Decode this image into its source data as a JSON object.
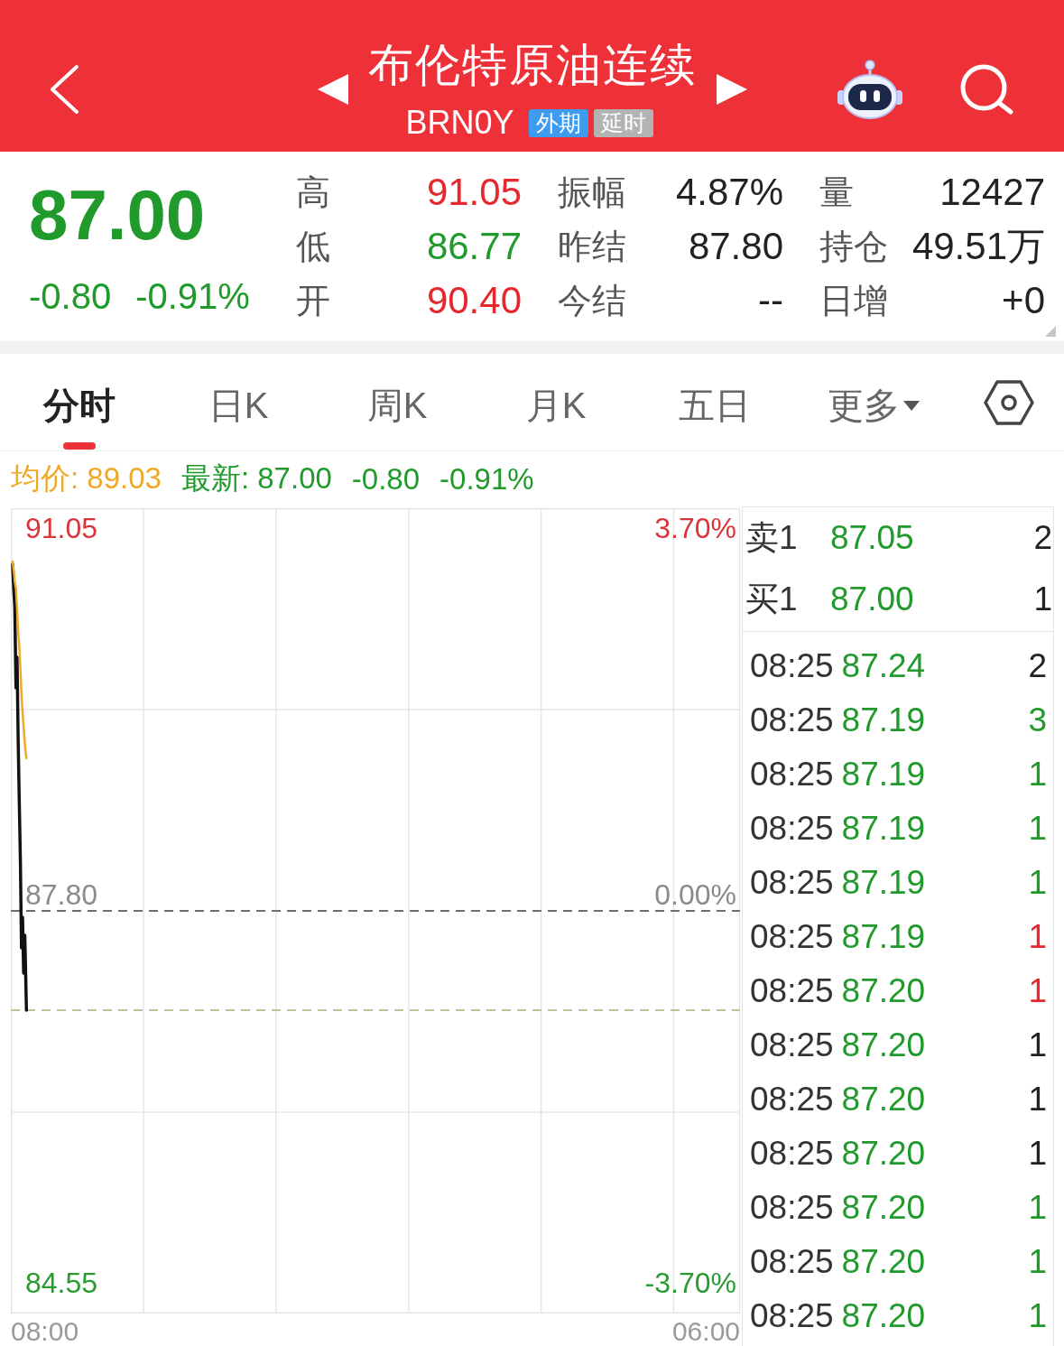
{
  "header": {
    "title": "布伦特原油连续",
    "code": "BRN0Y",
    "badges": [
      {
        "text": "外期",
        "color": "#3d9cf0"
      },
      {
        "text": "延时",
        "color": "#b3b3b3"
      }
    ]
  },
  "quote": {
    "price": "87.00",
    "change": "-0.80",
    "change_pct": "-0.91%",
    "color": "#1f9a2b",
    "stats": [
      {
        "label": "高",
        "value": "91.05",
        "color": "#e8262d"
      },
      {
        "label": "振幅",
        "value": "4.87%",
        "color": "#222222"
      },
      {
        "label": "量",
        "value": "12427",
        "color": "#222222"
      },
      {
        "label": "低",
        "value": "86.77",
        "color": "#1f9a2b"
      },
      {
        "label": "昨结",
        "value": "87.80",
        "color": "#222222"
      },
      {
        "label": "持仓",
        "value": "49.51万",
        "color": "#222222"
      },
      {
        "label": "开",
        "value": "90.40",
        "color": "#e8262d"
      },
      {
        "label": "今结",
        "value": "--",
        "color": "#222222"
      },
      {
        "label": "日增",
        "value": "+0",
        "color": "#222222"
      }
    ]
  },
  "tabs": [
    {
      "label": "分时",
      "selected": true,
      "kind": "plain"
    },
    {
      "label": "日K",
      "selected": false,
      "kind": "plain"
    },
    {
      "label": "周K",
      "selected": false,
      "kind": "plain"
    },
    {
      "label": "月K",
      "selected": false,
      "kind": "plain"
    },
    {
      "label": "五日",
      "selected": false,
      "kind": "plain"
    },
    {
      "label": "更多",
      "selected": false,
      "kind": "menu"
    }
  ],
  "indicators": [
    {
      "text": "均价: 89.03",
      "color": "#f0a829"
    },
    {
      "text": "最新: 87.00",
      "color": "#1f9a2b"
    },
    {
      "text": "-0.80",
      "color": "#1f9a2b"
    },
    {
      "text": "-0.91%",
      "color": "#1f9a2b"
    }
  ],
  "chart": {
    "left_labels": [
      {
        "text": "91.05",
        "color": "#d9343a"
      },
      {
        "text": "87.80",
        "color": "#8a8a8a"
      },
      {
        "text": "84.55",
        "color": "#2a9a32"
      }
    ],
    "right_labels": [
      {
        "text": "3.70%",
        "color": "#d9343a"
      },
      {
        "text": "0.00%",
        "color": "#8a8a8a"
      },
      {
        "text": "-3.70%",
        "color": "#2a9a32"
      }
    ],
    "time_labels": [
      "08:00",
      "06:00"
    ]
  },
  "order_book": [
    {
      "label": "卖1",
      "price": "87.05",
      "volume": "2"
    },
    {
      "label": "买1",
      "price": "87.00",
      "volume": "1"
    }
  ],
  "trades": [
    {
      "time": "08:25",
      "price": "87.24",
      "volume": "2",
      "color": "#222222"
    },
    {
      "time": "08:25",
      "price": "87.19",
      "volume": "3",
      "color": "#1f9a2b"
    },
    {
      "time": "08:25",
      "price": "87.19",
      "volume": "1",
      "color": "#1f9a2b"
    },
    {
      "time": "08:25",
      "price": "87.19",
      "volume": "1",
      "color": "#1f9a2b"
    },
    {
      "time": "08:25",
      "price": "87.19",
      "volume": "1",
      "color": "#1f9a2b"
    },
    {
      "time": "08:25",
      "price": "87.19",
      "volume": "1",
      "color": "#e8262d"
    },
    {
      "time": "08:25",
      "price": "87.20",
      "volume": "1",
      "color": "#e8262d"
    },
    {
      "time": "08:25",
      "price": "87.20",
      "volume": "1",
      "color": "#222222"
    },
    {
      "time": "08:25",
      "price": "87.20",
      "volume": "1",
      "color": "#222222"
    },
    {
      "time": "08:25",
      "price": "87.20",
      "volume": "1",
      "color": "#222222"
    },
    {
      "time": "08:25",
      "price": "87.20",
      "volume": "1",
      "color": "#1f9a2b"
    },
    {
      "time": "08:25",
      "price": "87.20",
      "volume": "1",
      "color": "#1f9a2b"
    },
    {
      "time": "08:25",
      "price": "87.20",
      "volume": "1",
      "color": "#1f9a2b"
    }
  ]
}
